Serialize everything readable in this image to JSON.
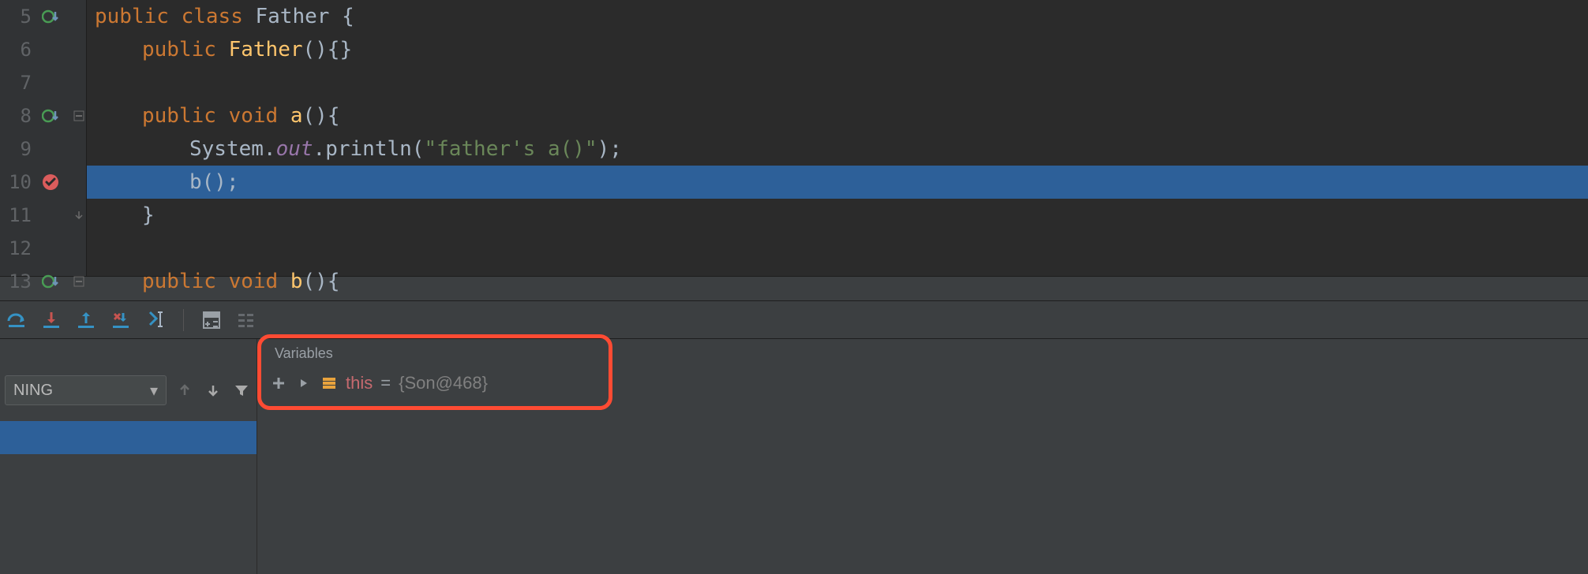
{
  "editor": {
    "lines": [
      {
        "n": "5",
        "gutter": "override",
        "fold": "",
        "tokens": [
          [
            "kw",
            "public "
          ],
          [
            "kw",
            "class "
          ],
          [
            "cls",
            "Father "
          ],
          [
            "id",
            "{"
          ]
        ]
      },
      {
        "n": "6",
        "gutter": "",
        "fold": "",
        "indent": 1,
        "tokens": [
          [
            "kw",
            "public "
          ],
          [
            "mth",
            "Father"
          ],
          [
            "id",
            "(){}"
          ]
        ]
      },
      {
        "n": "7",
        "gutter": "",
        "fold": "",
        "tokens": []
      },
      {
        "n": "8",
        "gutter": "override",
        "fold": "minus",
        "indent": 1,
        "tokens": [
          [
            "kw",
            "public "
          ],
          [
            "kw",
            "void "
          ],
          [
            "mth",
            "a"
          ],
          [
            "id",
            "(){"
          ]
        ]
      },
      {
        "n": "9",
        "gutter": "",
        "fold": "",
        "indent": 2,
        "tokens": [
          [
            "id",
            "System."
          ],
          [
            "stat",
            "out"
          ],
          [
            "id",
            ".println("
          ],
          [
            "str",
            "\"father's a()\""
          ],
          [
            "id",
            ");"
          ]
        ]
      },
      {
        "n": "10",
        "gutter": "breakpoint",
        "fold": "",
        "hl": true,
        "indent": 2,
        "tokens": [
          [
            "id",
            "b();"
          ]
        ]
      },
      {
        "n": "11",
        "gutter": "",
        "fold": "end",
        "indent": 1,
        "tokens": [
          [
            "id",
            "}"
          ]
        ]
      },
      {
        "n": "12",
        "gutter": "",
        "fold": "",
        "tokens": []
      },
      {
        "n": "13",
        "gutter": "override",
        "fold": "minus",
        "indent": 1,
        "tokens": [
          [
            "kw",
            "public "
          ],
          [
            "kw",
            "void "
          ],
          [
            "mth",
            "b"
          ],
          [
            "id",
            "(){"
          ]
        ]
      }
    ]
  },
  "debugToolbar": {
    "stepOver": "step-over",
    "stepInto": "step-into",
    "stepOut": "step-out",
    "forceStepInto": "force-step-into",
    "runToCursor": "run-to-cursor",
    "evaluate": "evaluate-expression",
    "trace": "trace"
  },
  "frames": {
    "threadLabel": "NING",
    "prev": "prev-frame",
    "next": "next-frame",
    "filter": "filter"
  },
  "variables": {
    "title": "Variables",
    "add": "+",
    "row": {
      "name": "this",
      "eq": " = ",
      "value": "{Son@468}"
    }
  }
}
